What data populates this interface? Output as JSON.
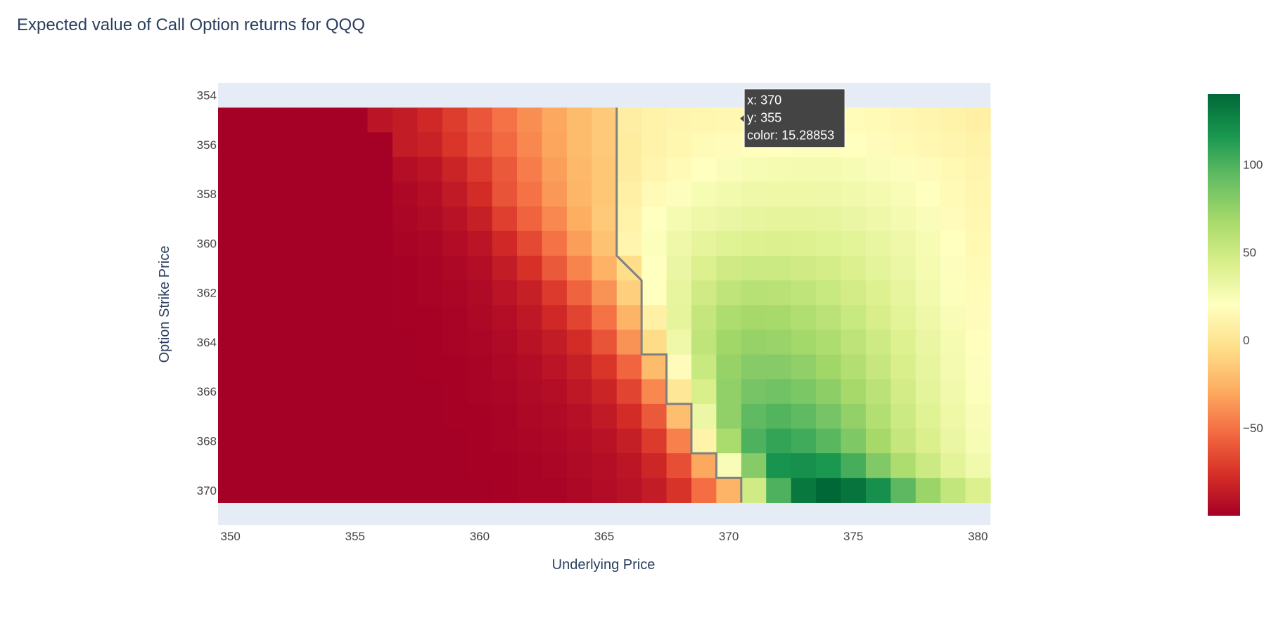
{
  "chart_data": {
    "type": "heatmap",
    "title": "Expected value of Call Option returns for QQQ",
    "xlabel": "Underlying Price",
    "ylabel": "Option Strike Price",
    "x": [
      350,
      351,
      352,
      353,
      354,
      355,
      356,
      357,
      358,
      359,
      360,
      361,
      362,
      363,
      364,
      365,
      366,
      367,
      368,
      369,
      370,
      371,
      372,
      373,
      374,
      375,
      376,
      377,
      378,
      379,
      380
    ],
    "y": [
      355,
      356,
      357,
      358,
      359,
      360,
      361,
      362,
      363,
      364,
      365,
      366,
      367,
      368,
      369,
      370
    ],
    "x_ticks": [
      350,
      355,
      360,
      365,
      370,
      375,
      380
    ],
    "y_ticks": [
      354,
      356,
      358,
      360,
      362,
      364,
      366,
      368,
      370
    ],
    "colorbar": {
      "range": [
        -100,
        140
      ],
      "ticks": [
        100,
        50,
        0,
        -50
      ],
      "tick_labels": [
        "100",
        "50",
        "0",
        "−50"
      ],
      "colorscale": "RdYlGn"
    },
    "z": [
      [
        -100,
        -100,
        -100,
        -100,
        -100,
        -100,
        -90,
        -86,
        -80,
        -71,
        -61,
        -50,
        -40,
        -30,
        -22,
        -15,
        7,
        10,
        12,
        13,
        14,
        15,
        16,
        17,
        18,
        17,
        16,
        14,
        12,
        10,
        8
      ],
      [
        -100,
        -100,
        -100,
        -100,
        -100,
        -100,
        -100,
        -86,
        -83,
        -74,
        -64,
        -54,
        -42,
        -31,
        -22,
        -15,
        5,
        10,
        13,
        16,
        18,
        19,
        20,
        21,
        21,
        20,
        18,
        16,
        14,
        12,
        10
      ],
      [
        -100,
        -100,
        -100,
        -100,
        -100,
        -100,
        -100,
        -93,
        -90,
        -82,
        -72,
        -60,
        -46,
        -34,
        -23,
        -16,
        6,
        12,
        16,
        20,
        23,
        25,
        26,
        27,
        27,
        25,
        23,
        21,
        18,
        15,
        12
      ],
      [
        -100,
        -100,
        -100,
        -100,
        -100,
        -100,
        -100,
        -96,
        -93,
        -87,
        -78,
        -62,
        -50,
        -36,
        -24,
        -16,
        8,
        16,
        21,
        25,
        28,
        30,
        31,
        31,
        30,
        29,
        27,
        24,
        20,
        16,
        13
      ],
      [
        -100,
        -100,
        -100,
        -100,
        -100,
        -100,
        -100,
        -97,
        -95,
        -91,
        -84,
        -70,
        -56,
        -42,
        -28,
        -15,
        10,
        20,
        26,
        30,
        33,
        35,
        36,
        36,
        35,
        33,
        30,
        27,
        23,
        18,
        14
      ],
      [
        -100,
        -100,
        -100,
        -100,
        -100,
        -100,
        -100,
        -98,
        -97,
        -94,
        -90,
        -80,
        -66,
        -50,
        -34,
        -18,
        12,
        22,
        30,
        36,
        40,
        41,
        42,
        41,
        40,
        38,
        34,
        30,
        25,
        20,
        15
      ],
      [
        -100,
        -100,
        -100,
        -100,
        -100,
        -100,
        -100,
        -99,
        -98,
        -96,
        -93,
        -86,
        -76,
        -60,
        -44,
        -26,
        -5,
        20,
        33,
        42,
        48,
        50,
        50,
        48,
        46,
        42,
        37,
        32,
        26,
        21,
        16
      ],
      [
        -100,
        -100,
        -100,
        -100,
        -100,
        -100,
        -100,
        -99,
        -98,
        -97,
        -95,
        -90,
        -84,
        -72,
        -56,
        -38,
        -12,
        20,
        35,
        48,
        56,
        60,
        59,
        56,
        52,
        47,
        41,
        35,
        28,
        22,
        17
      ],
      [
        -100,
        -100,
        -100,
        -100,
        -100,
        -100,
        -100,
        -99,
        -99,
        -98,
        -96,
        -93,
        -88,
        -80,
        -68,
        -50,
        -25,
        8,
        36,
        54,
        64,
        68,
        67,
        63,
        58,
        52,
        45,
        38,
        30,
        24,
        18
      ],
      [
        -100,
        -100,
        -100,
        -100,
        -100,
        -100,
        -100,
        -100,
        -99,
        -98,
        -97,
        -95,
        -91,
        -86,
        -78,
        -62,
        -38,
        -6,
        30,
        56,
        70,
        74,
        73,
        69,
        64,
        57,
        49,
        41,
        33,
        26,
        19
      ],
      [
        -100,
        -100,
        -100,
        -100,
        -100,
        -100,
        -100,
        -100,
        -99,
        -99,
        -98,
        -96,
        -94,
        -90,
        -84,
        -74,
        -55,
        -22,
        18,
        52,
        74,
        80,
        80,
        76,
        70,
        62,
        53,
        44,
        35,
        27,
        21
      ],
      [
        -100,
        -100,
        -100,
        -100,
        -100,
        -100,
        -100,
        -100,
        -100,
        -99,
        -98,
        -97,
        -95,
        -93,
        -88,
        -82,
        -68,
        -42,
        2,
        44,
        76,
        86,
        88,
        84,
        77,
        68,
        58,
        47,
        37,
        29,
        22
      ],
      [
        -100,
        -100,
        -100,
        -100,
        -100,
        -100,
        -100,
        -100,
        -100,
        -99,
        -99,
        -98,
        -96,
        -95,
        -92,
        -87,
        -78,
        -60,
        -20,
        32,
        76,
        94,
        98,
        94,
        86,
        75,
        62,
        50,
        40,
        31,
        24
      ],
      [
        -100,
        -100,
        -100,
        -100,
        -100,
        -100,
        -100,
        -100,
        -100,
        -100,
        -99,
        -98,
        -97,
        -96,
        -94,
        -91,
        -85,
        -72,
        -45,
        10,
        66,
        100,
        108,
        104,
        96,
        83,
        68,
        54,
        43,
        33,
        25
      ],
      [
        -100,
        -100,
        -100,
        -100,
        -100,
        -100,
        -100,
        -100,
        -100,
        -100,
        -99,
        -99,
        -98,
        -97,
        -95,
        -93,
        -89,
        -81,
        -64,
        -30,
        24,
        80,
        118,
        120,
        116,
        102,
        82,
        64,
        50,
        38,
        29
      ],
      [
        -100,
        -100,
        -100,
        -100,
        -100,
        -100,
        -100,
        -100,
        -100,
        -100,
        -100,
        -99,
        -98,
        -98,
        -96,
        -94,
        -91,
        -86,
        -75,
        -52,
        -25,
        48,
        100,
        132,
        140,
        134,
        120,
        95,
        72,
        55,
        42
      ]
    ],
    "breakeven_line": {
      "points": [
        [
          365.5,
          354.5
        ],
        [
          365.5,
          360.5
        ],
        [
          366.5,
          361.5
        ],
        [
          366.5,
          364.5
        ],
        [
          367.5,
          364.5
        ],
        [
          367.5,
          366.5
        ],
        [
          368.5,
          366.5
        ],
        [
          368.5,
          368.5
        ],
        [
          369.5,
          368.5
        ],
        [
          369.5,
          369.5
        ],
        [
          370.5,
          369.5
        ],
        [
          370.5,
          370.5
        ]
      ],
      "color": "#808080"
    },
    "hover": {
      "x_text": "x: 370",
      "y_text": "y: 355",
      "z_text": "color: 15.28853",
      "x": 370,
      "y": 355
    },
    "colors": {
      "plot_bg": "#e5ecf6",
      "text": "#2a3f5f",
      "tooltip_bg": "#444444"
    }
  }
}
